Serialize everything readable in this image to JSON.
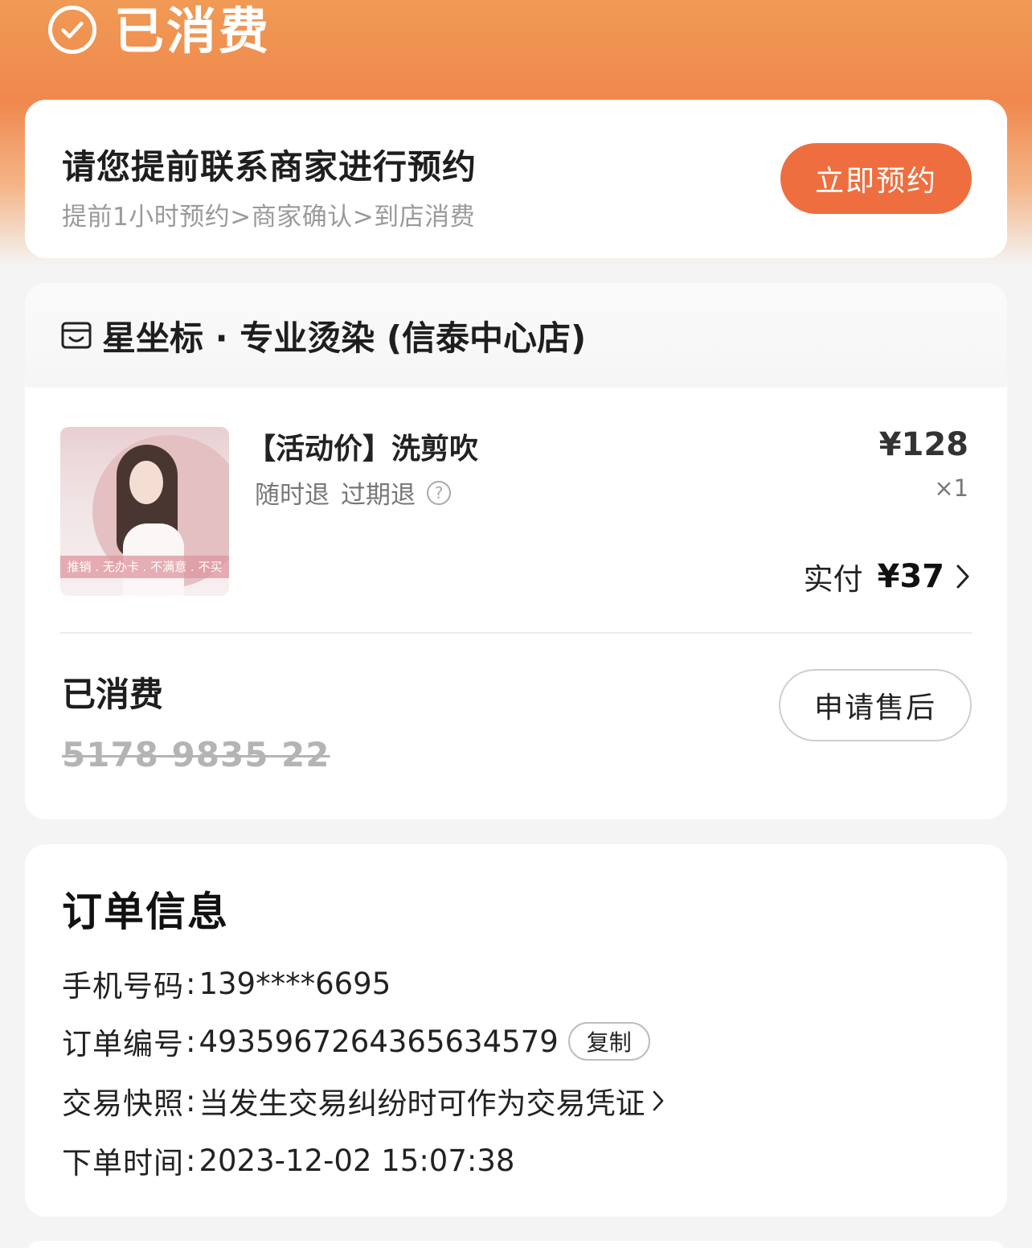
{
  "status": {
    "title": "已消费",
    "icon": "check-circle-icon"
  },
  "booking": {
    "headline": "请您提前联系商家进行预约",
    "steps": "提前1小时预约>商家确认>到店消费",
    "button_label": "立即预约",
    "accent_color": "#ee6e3f"
  },
  "shop": {
    "icon": "store-icon",
    "name": "星坐标 · 专业烫染 (信泰中心店)"
  },
  "product": {
    "title": "【活动价】洗剪吹",
    "tag_refund_anytime": "随时退",
    "tag_refund_expired": "过期退",
    "help_icon": "question-circle-icon",
    "original_price": "¥128",
    "quantity": "×1",
    "paid_label": "实付",
    "paid_amount": "¥37",
    "thumb_band_text": "推销 . 无办卡 . 不满意 . 不买"
  },
  "voucher": {
    "status_label": "已消费",
    "code": "5178 9835 22",
    "aftersale_label": "申请售后"
  },
  "order_info": {
    "title": "订单信息",
    "rows": [
      {
        "key": "手机号码",
        "value": "139****6695"
      },
      {
        "key": "订单编号",
        "value": "4935967264365634579",
        "action": "复制"
      },
      {
        "key": "交易快照",
        "value": "当发生交易纠纷时可作为交易凭证"
      },
      {
        "key": "下单时间",
        "value": "2023-12-02 15:07:38"
      }
    ]
  }
}
